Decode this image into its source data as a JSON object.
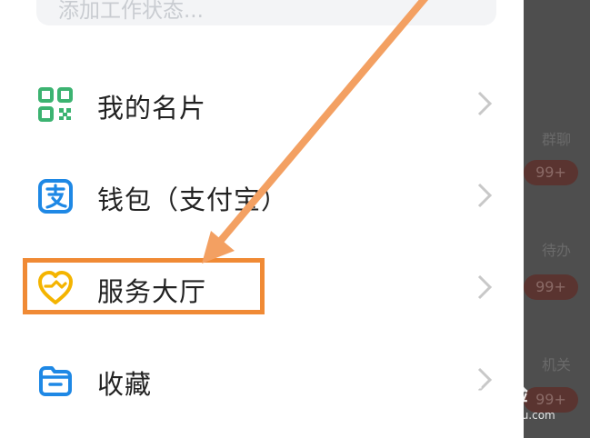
{
  "status_input": {
    "placeholder": "添加工作状态..."
  },
  "menu": {
    "items": [
      {
        "label": "我的名片",
        "icon": "qr-code-icon",
        "color": "#3cb371"
      },
      {
        "label": "钱包（支付宝）",
        "icon": "alipay-wallet-icon",
        "color": "#1e88e5"
      },
      {
        "label": "服务大厅",
        "icon": "heart-service-icon",
        "color": "#f4b400"
      },
      {
        "label": "收藏",
        "icon": "folder-icon",
        "color": "#1e88e5"
      }
    ]
  },
  "background": {
    "texts": [
      "群聊",
      "待办",
      "机关"
    ],
    "badges": [
      "99+",
      "99+",
      "99+"
    ]
  },
  "annotation": {
    "highlight_color": "#f08a35"
  },
  "watermark": {
    "main": "Bai 经验",
    "sub": "jingyan.baidu.com"
  }
}
